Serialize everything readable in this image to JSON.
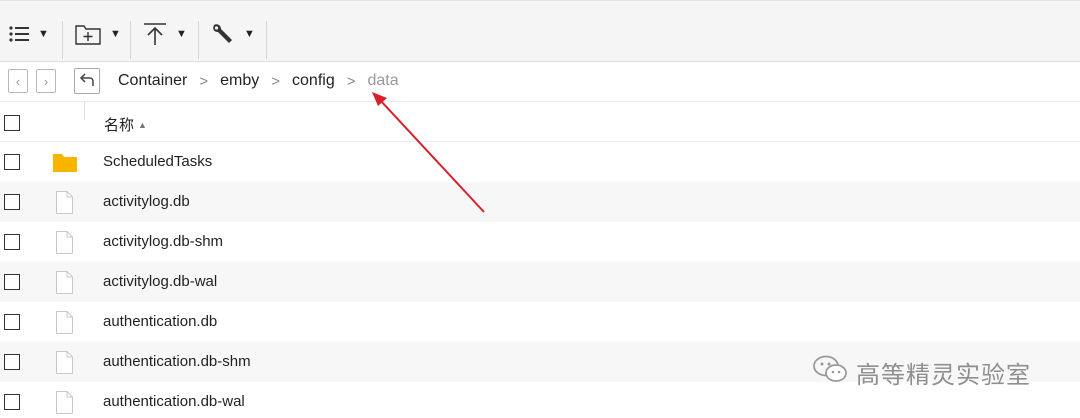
{
  "toolbar": {
    "buttons": [
      {
        "icon": "list-view-icon"
      },
      {
        "icon": "new-folder-icon"
      },
      {
        "icon": "upload-icon"
      },
      {
        "icon": "tools-icon"
      }
    ]
  },
  "breadcrumb": {
    "items": [
      "Container",
      "emby",
      "config",
      "data"
    ],
    "separator": ">"
  },
  "header": {
    "name_label": "名称",
    "sort_indicator": "▲"
  },
  "files": [
    {
      "name": "ScheduledTasks",
      "type": "folder"
    },
    {
      "name": "activitylog.db",
      "type": "file"
    },
    {
      "name": "activitylog.db-shm",
      "type": "file"
    },
    {
      "name": "activitylog.db-wal",
      "type": "file"
    },
    {
      "name": "authentication.db",
      "type": "file"
    },
    {
      "name": "authentication.db-shm",
      "type": "file"
    },
    {
      "name": "authentication.db-wal",
      "type": "file"
    }
  ],
  "watermark": {
    "text": "高等精灵实验室"
  },
  "colors": {
    "folder": "#f7b500",
    "arrow": "#d7202a",
    "toolbar_bg": "#f5f5f5",
    "row_alt": "#f7f7f7"
  }
}
